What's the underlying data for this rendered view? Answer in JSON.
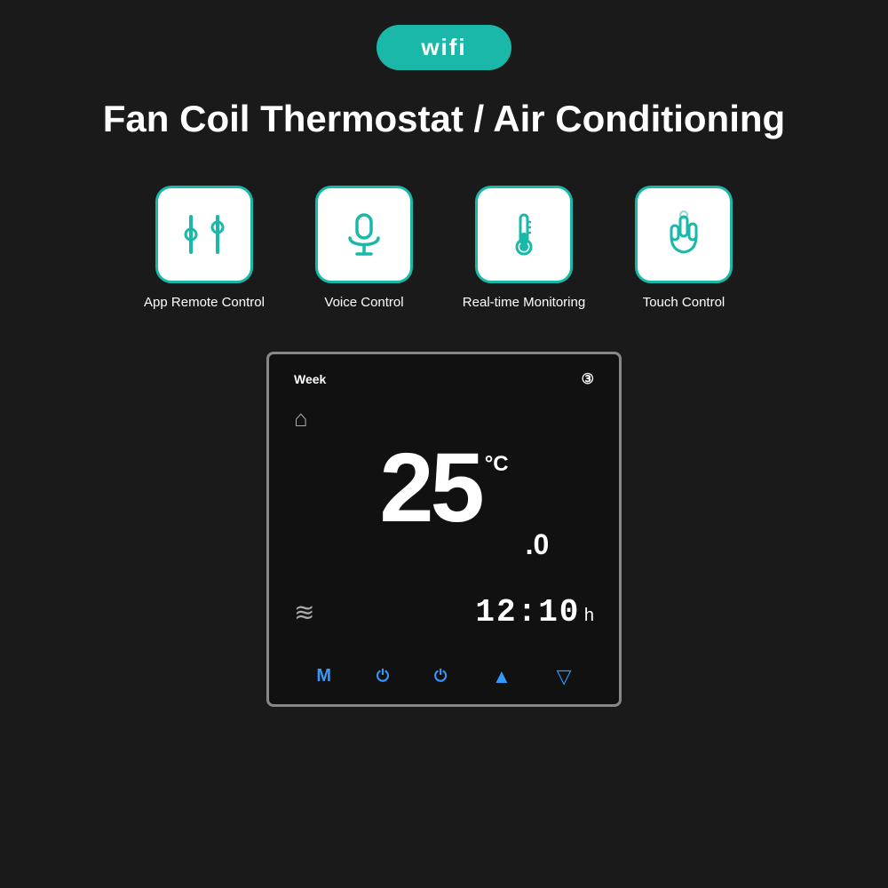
{
  "badge": {
    "label": "wifi",
    "bg_color": "#1ab8a8"
  },
  "title": "Fan Coil Thermostat / Air Conditioning",
  "features": [
    {
      "id": "app-remote",
      "label": "App Remote\nControl",
      "icon": "sliders"
    },
    {
      "id": "voice",
      "label": "Voice\nControl",
      "icon": "microphone"
    },
    {
      "id": "realtime",
      "label": "Real-time\nMonitoring",
      "icon": "thermometer"
    },
    {
      "id": "touch",
      "label": "Touch\nControl",
      "icon": "hand"
    }
  ],
  "thermostat": {
    "week_label": "Week",
    "period_icon": "③",
    "temperature": "25",
    "temp_unit": "°C",
    "temp_decimal": ".0",
    "time": "12:10",
    "time_unit": "h",
    "buttons": [
      "M",
      "⏻",
      "⏻",
      "▲",
      "▽"
    ]
  }
}
